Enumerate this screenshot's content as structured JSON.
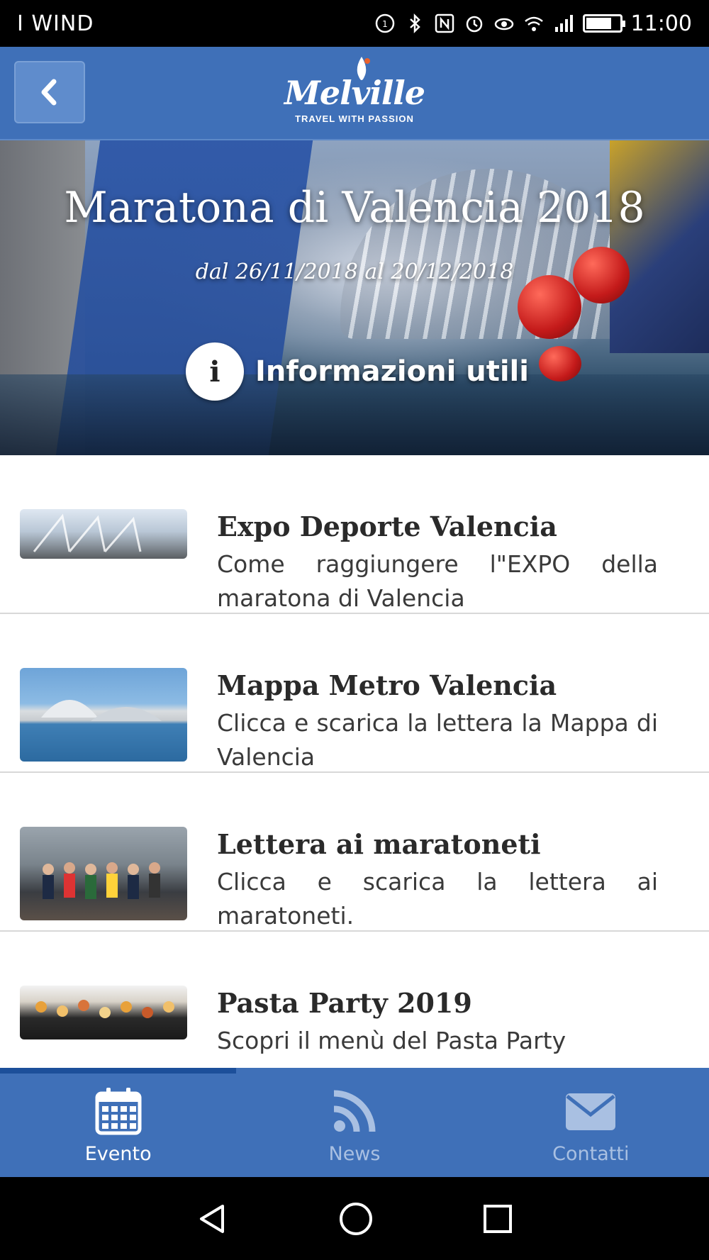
{
  "status_bar": {
    "carrier": "I WIND",
    "time": "11:00",
    "icons": [
      "sim-icon",
      "bluetooth-icon",
      "nfc-icon",
      "alarm-icon",
      "eye-comfort-icon",
      "wifi-icon",
      "signal-icon",
      "battery-icon"
    ],
    "battery_level": 0.75
  },
  "header": {
    "logo_text": "Melville",
    "logo_tagline": "TRAVEL WITH PASSION",
    "back_icon": "chevron-left-icon"
  },
  "hero": {
    "title": "Maratona di Valencia 2018",
    "dates": "dal 26/11/2018 al 20/12/2018",
    "info_button_label": "Informazioni utili",
    "info_icon": "info-icon"
  },
  "items": [
    {
      "title": "Expo Deporte Valencia",
      "description": "Come raggiungere l\"EXPO della maratona di Valencia"
    },
    {
      "title": "Mappa Metro Valencia",
      "description": "Clicca e scarica la lettera la Mappa di Valencia"
    },
    {
      "title": "Lettera ai maratoneti",
      "description": "Clicca e scarica la lettera ai maratoneti."
    },
    {
      "title": "Pasta Party 2019",
      "description": "Scopri il menù del Pasta Party"
    }
  ],
  "scroll_progress": 0.333,
  "tabs": [
    {
      "label": "Evento",
      "icon": "calendar-icon",
      "active": true
    },
    {
      "label": "News",
      "icon": "rss-icon",
      "active": false
    },
    {
      "label": "Contatti",
      "icon": "envelope-icon",
      "active": false
    }
  ],
  "colors": {
    "primary": "#3f70b8",
    "tab_inactive": "#a9c0e2",
    "progress": "#1c4f9a"
  }
}
